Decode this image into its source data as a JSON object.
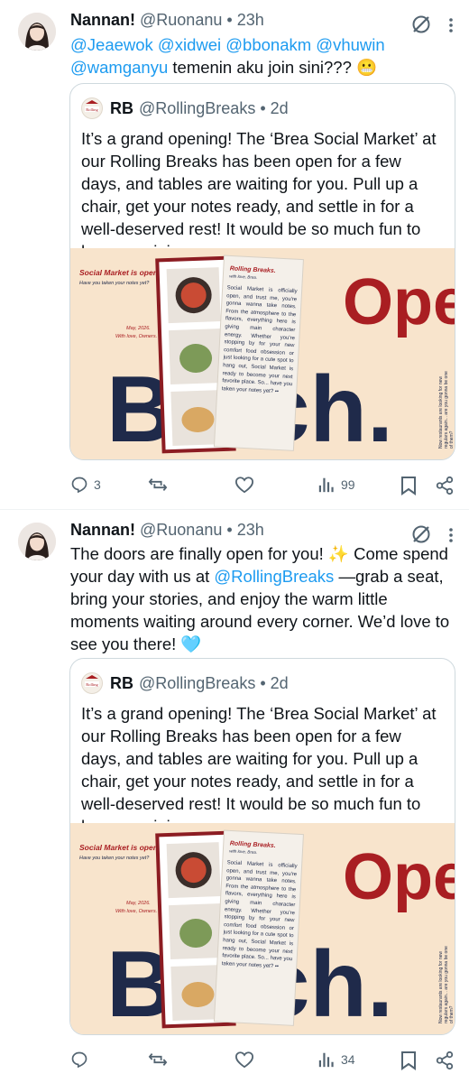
{
  "posts": [
    {
      "author": {
        "name": "Nannan!",
        "handle": "@Ruonanu",
        "time": "23h"
      },
      "text": {
        "mentions": "@Jeaewok @xidwei @bbonakm @vhuwin",
        "mention_last": "@wamganyu",
        "after": " temenin aku join sini??? ",
        "emoji": "😬"
      },
      "quote": {
        "name": "RB",
        "handle": "@RollingBreaks",
        "time": "2d",
        "avatar_text": "Rolling",
        "text": "It’s a grand opening! The ‘Brea Social Market’ at our Rolling Breaks has been open for a few days, and tables are waiting for you. Pull up a chair, get your notes ready, and settle in for a well-deserved rest! It would be so much fun to have you join us.",
        "image": {
          "headline": "Social Market is open.",
          "subline": "Have you taken your notes yet?",
          "date": "May, 2026.",
          "signoff": "With love, Owners.",
          "card_title": "Rolling Breaks.",
          "card_sub": "with love, Brea.",
          "card_body": "Social Market is officially open, and trust me, you're gonna wanna take notes. From the atmosphere to the flavors, everything here is giving main character energy. Whether you're stopping by for your new comfort food obsession or just looking for a cute spot to hang out, Social Market is ready to become your next favorite place. So... have you taken your notes yet? ••",
          "big1": "Open",
          "big2": "Batch.",
          "side_note": "Now restaurants are looking for new regulars again... are you gonna be one of them?"
        }
      },
      "stats": {
        "replies": "3",
        "reposts": "",
        "likes": "",
        "views": "99"
      }
    },
    {
      "author": {
        "name": "Nannan!",
        "handle": "@Ruonanu",
        "time": "23h"
      },
      "text": {
        "before": "The doors are finally open for you! ",
        "sparkle": "✨",
        "middle": " Come spend your day with us at ",
        "mention": "@RollingBreaks",
        "after": " —grab a seat, bring your stories, and enjoy the warm little moments waiting around every corner. We’d love to see you there! ",
        "emoji": "🩵"
      },
      "quote": {
        "name": "RB",
        "handle": "@RollingBreaks",
        "time": "2d",
        "avatar_text": "Rolling",
        "text": "It’s a grand opening! The ‘Brea Social Market’ at our Rolling Breaks has been open for a few days, and tables are waiting for you. Pull up a chair, get your notes ready, and settle in for a well-deserved rest! It would be so much fun to have you join us.",
        "image": {
          "headline": "Social Market is open.",
          "subline": "Have you taken your notes yet?",
          "date": "May, 2026.",
          "signoff": "With love, Owners.",
          "card_title": "Rolling Breaks.",
          "card_sub": "with love, Brea.",
          "card_body": "Social Market is officially open, and trust me, you're gonna wanna take notes. From the atmosphere to the flavors, everything here is giving main character energy. Whether you're stopping by for your new comfort food obsession or just looking for a cute spot to hang out, Social Market is ready to become your next favorite place. So... have you taken your notes yet? ••",
          "big1": "Open",
          "big2": "Batch.",
          "side_note": "Now restaurants are looking for new regulars again... are you gonna be one of them?"
        }
      },
      "stats": {
        "replies": "",
        "reposts": "",
        "likes": "",
        "views": "34"
      }
    }
  ],
  "icons": {
    "reply": "reply-icon",
    "repost": "repost-icon",
    "like": "heart-icon",
    "views": "views-icon",
    "bookmark": "bookmark-icon",
    "share": "share-icon",
    "grok": "grok-icon"
  },
  "colors": {
    "text": "#0f1419",
    "secondary": "#536471",
    "link": "#1d9bf0",
    "border": "#cfd9de",
    "poster_bg": "#f8e4cc",
    "poster_red": "#a91e22",
    "poster_navy": "#1f2a4a"
  }
}
